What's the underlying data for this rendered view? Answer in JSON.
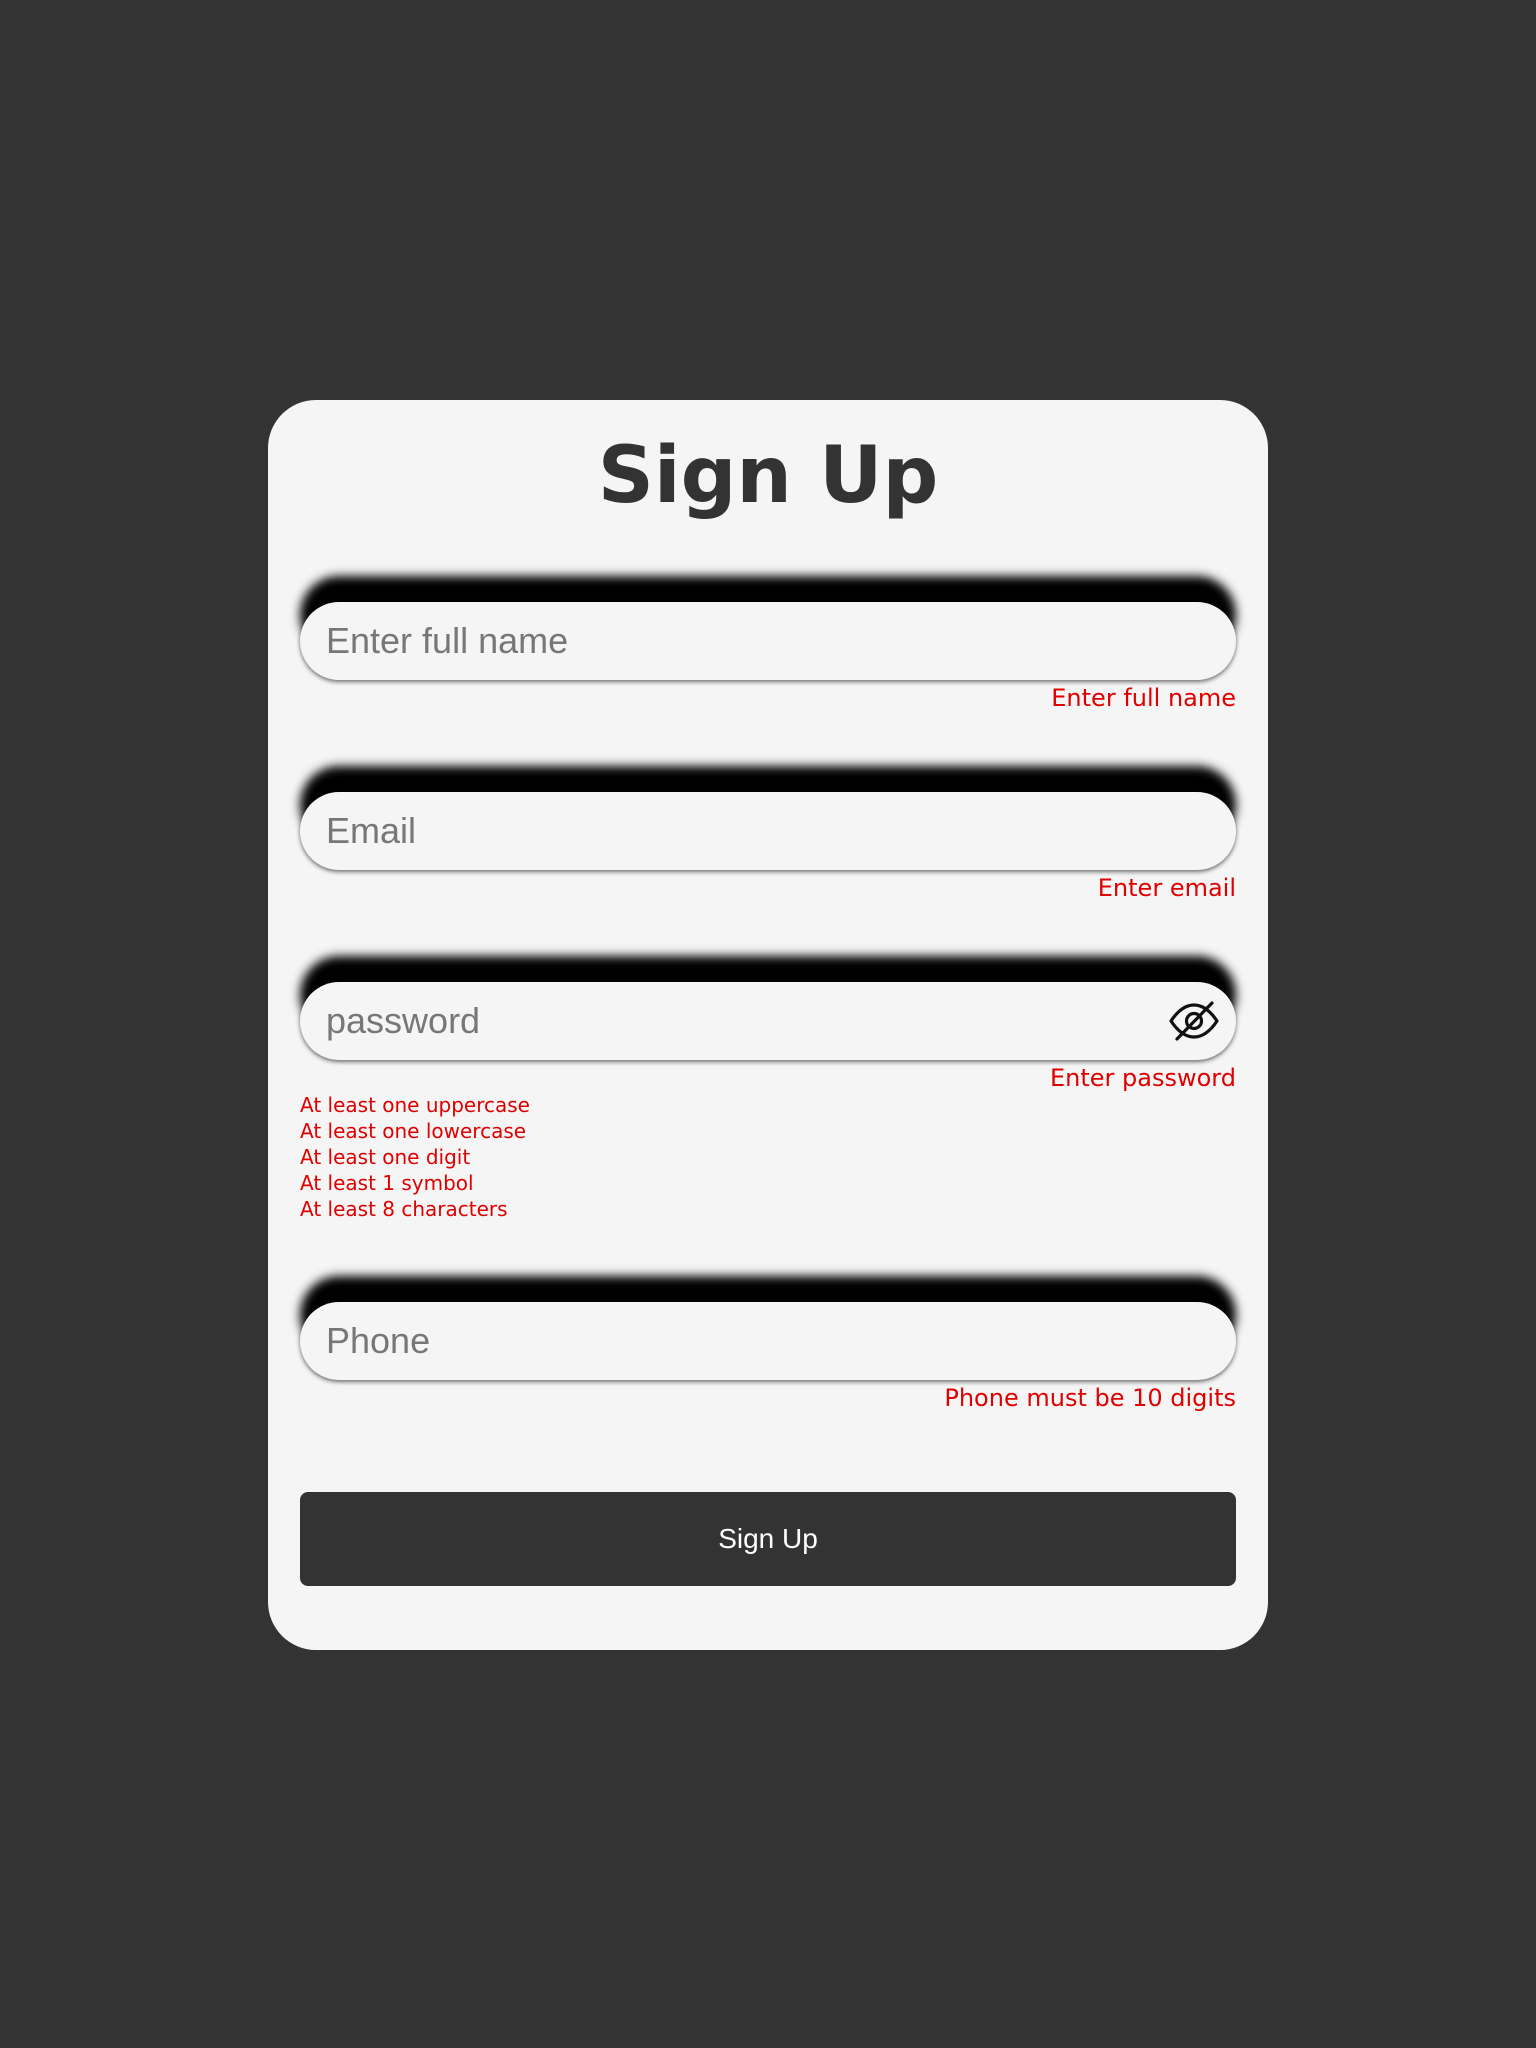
{
  "form": {
    "title": "Sign Up",
    "fields": {
      "name": {
        "placeholder": "Enter full name",
        "value": "",
        "error": "Enter full name"
      },
      "email": {
        "placeholder": "Email",
        "value": "",
        "error": "Enter email"
      },
      "password": {
        "placeholder": "password",
        "value": "",
        "error": "Enter password",
        "toggle_icon": "eye-off-icon",
        "rules": [
          "At least one uppercase",
          "At least one lowercase",
          "At least one digit",
          "At least 1 symbol",
          "At least 8 characters"
        ]
      },
      "phone": {
        "placeholder": "Phone",
        "value": "",
        "error": "Phone must be 10 digits"
      }
    },
    "submit_label": "Sign Up"
  },
  "colors": {
    "background": "#333333",
    "card": "#f5f5f5",
    "error": "#e00000",
    "button": "#333333",
    "button_text": "#ffffff"
  }
}
